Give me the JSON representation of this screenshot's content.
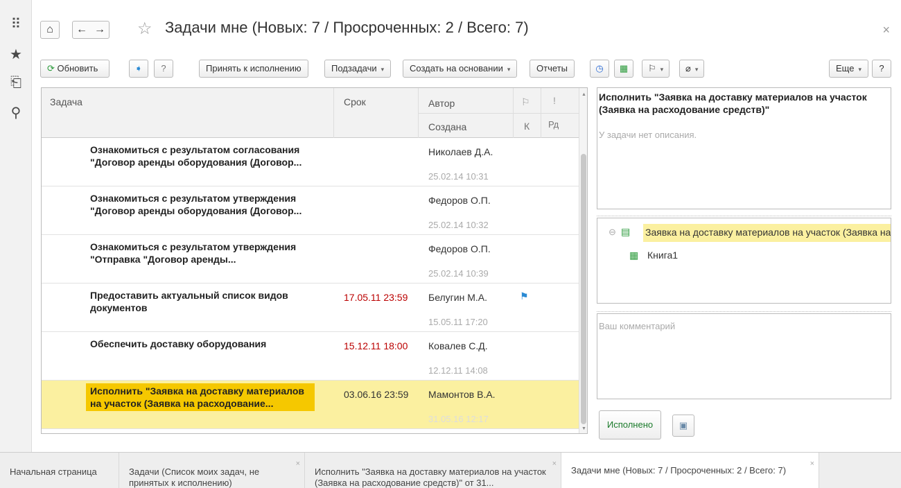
{
  "window": {
    "title": "Задачи мне (Новых: 7 / Просроченных: 2 / Всего: 7)",
    "close_glyph": "×"
  },
  "rail": {
    "icons": [
      "apps-grid-icon",
      "favorites-star-icon",
      "history-icon",
      "search-icon"
    ],
    "glyphs": [
      "⠿",
      "★",
      "⎗",
      "⚲"
    ]
  },
  "nav": {
    "home_glyph": "⌂",
    "back_glyph": "←",
    "forward_glyph": "→",
    "star_glyph": "☆"
  },
  "toolbar": {
    "refresh_label": "Обновить",
    "refresh_glyph": "⟳",
    "arrow_glyph": "➧",
    "help_glyph": "?",
    "accept_label": "Принять к исполнению",
    "subtasks_label": "Подзадачи",
    "create_based_label": "Создать на основании",
    "reports_label": "Отчеты",
    "more_label": "Еще",
    "question_label": "?",
    "flag_glyph": "⚐",
    "clip_glyph": "⌀",
    "clock_glyph": "◷",
    "excel_glyph": "▦",
    "caret": "▾"
  },
  "table": {
    "headers": {
      "task": "Задача",
      "due": "Срок",
      "author": "Автор",
      "created": "Создана",
      "flag": "⚐",
      "priority": "!",
      "k": "К",
      "rd": "Рд"
    },
    "rows": [
      {
        "task": "Ознакомиться с результатом согласования \"Договор аренды оборудования (Договор...",
        "due": "",
        "author": "Николаев Д.А.",
        "created": "25.02.14 10:31",
        "flag": "",
        "overdue": false,
        "selected": false
      },
      {
        "task": "Ознакомиться с результатом утверждения \"Договор аренды оборудования (Договор...",
        "due": "",
        "author": "Федоров О.П.",
        "created": "25.02.14 10:32",
        "flag": "",
        "overdue": false,
        "selected": false
      },
      {
        "task": "Ознакомиться с результатом утверждения \"Отправка \"Договор аренды...",
        "due": "",
        "author": "Федоров О.П.",
        "created": "25.02.14 10:39",
        "flag": "",
        "overdue": false,
        "selected": false
      },
      {
        "task": "Предоставить актуальный список видов документов",
        "due": "17.05.11 23:59",
        "author": "Белугин М.А.",
        "created": "15.05.11 17:20",
        "flag": "⚑",
        "overdue": true,
        "selected": false
      },
      {
        "task": "Обеспечить доставку оборудования",
        "due": "15.12.11 18:00",
        "author": "Ковалев С.Д.",
        "created": "12.12.11 14:08",
        "flag": "",
        "overdue": true,
        "selected": false
      },
      {
        "task": "Исполнить \"Заявка на доставку материалов на участок (Заявка на расходование...",
        "due": "03.06.16 23:59",
        "author": "Мамонтов В.А.",
        "created": "31.05.16 12:17",
        "flag": "",
        "overdue": false,
        "selected": true
      }
    ]
  },
  "details": {
    "title": "Исполнить \"Заявка на доставку материалов на участок (Заявка на расходование средств)\"",
    "description_placeholder": "У задачи нет описания.",
    "attachment_root": "Заявка на доставку материалов на участок (Заявка на ра",
    "attachment_child": "Книга1",
    "collapse_glyph": "⊖",
    "comment_placeholder": "Ваш комментарий",
    "done_label": "Исполнено",
    "save_glyph": "▣"
  },
  "tabs": [
    {
      "label": "Начальная страница",
      "closable": false
    },
    {
      "label": "Задачи (Список моих задач, не принятых к исполнению)",
      "closable": true
    },
    {
      "label": "Исполнить \"Заявка на доставку материалов на участок (Заявка на расходование средств)\" от 31...",
      "closable": true
    },
    {
      "label": "Задачи мне (Новых: 7 / Просроченных: 2 / Всего: 7)",
      "closable": true,
      "active": true
    }
  ],
  "colors": {
    "selected_row": "#fbf0a0",
    "selected_text_bg": "#f5c800",
    "overdue": "#bb0000",
    "flag": "#2a8ad4",
    "attachment_highlight": "#fbf0a0"
  }
}
